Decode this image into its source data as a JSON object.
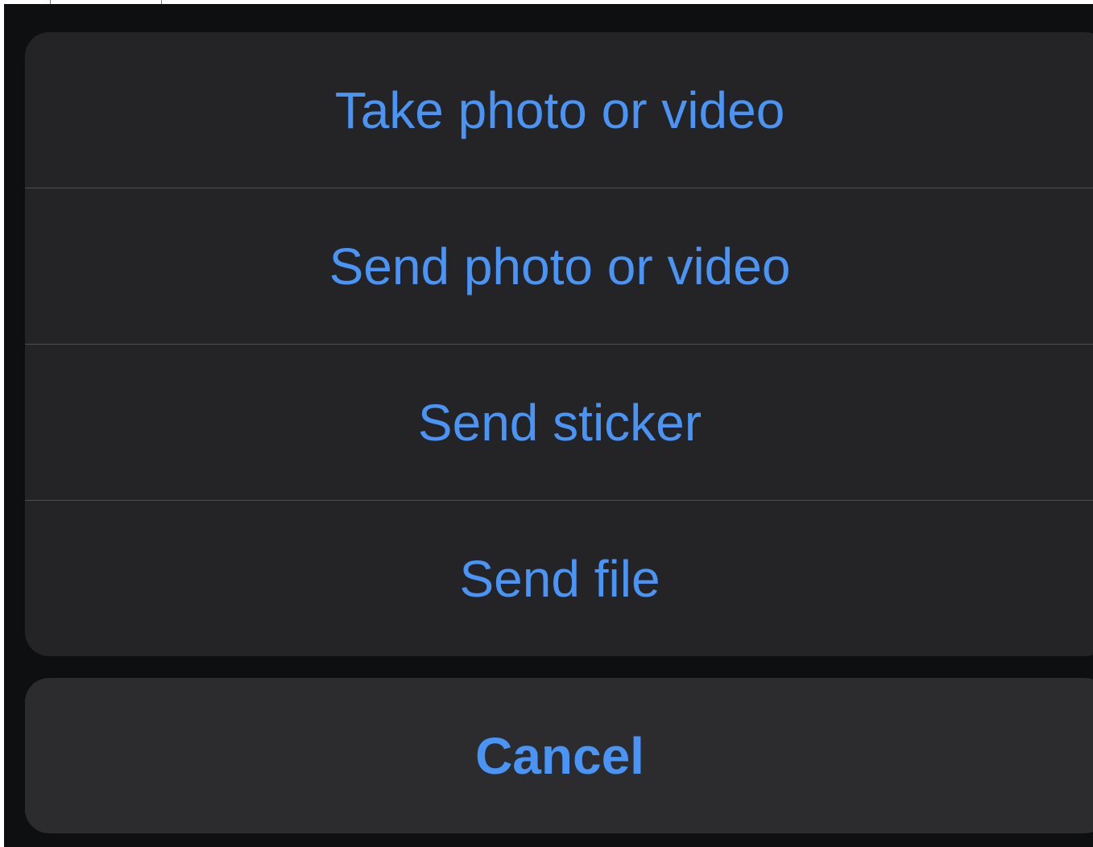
{
  "action_sheet": {
    "items": [
      {
        "label": "Take photo or video"
      },
      {
        "label": "Send photo or video"
      },
      {
        "label": "Send sticker"
      },
      {
        "label": "Send file"
      }
    ],
    "cancel_label": "Cancel"
  },
  "colors": {
    "accent": "#4a94f5",
    "backdrop": "#0e0f11",
    "sheet_background": "#242426",
    "cancel_background": "#2c2c2e",
    "divider": "#4d4d52"
  }
}
